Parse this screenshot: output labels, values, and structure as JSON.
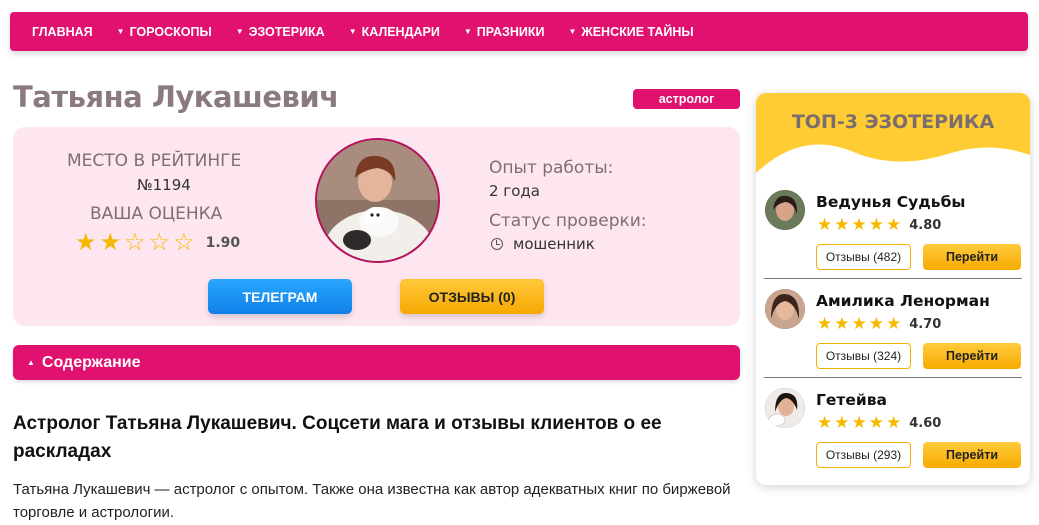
{
  "nav": {
    "items": [
      {
        "label": "ГЛАВНАЯ",
        "has_caret": false
      },
      {
        "label": "ГОРОСКОПЫ",
        "has_caret": true
      },
      {
        "label": "ЭЗОТЕРИКА",
        "has_caret": true
      },
      {
        "label": "КАЛЕНДАРИ",
        "has_caret": true
      },
      {
        "label": "ПРАЗНИКИ",
        "has_caret": true
      },
      {
        "label": "ЖЕНСКИЕ ТАЙНЫ",
        "has_caret": true
      }
    ]
  },
  "profile": {
    "name": "Татьяна Лукашевич",
    "badge": "астролог",
    "rank_label": "МЕСТО В РЕЙТИНГЕ",
    "rank_value": "№1194",
    "score_label": "ВАША ОЦЕНКА",
    "rating_value": "1.90",
    "rating_stars": 2,
    "experience_label": "Опыт работы:",
    "experience_value": "2 года",
    "status_label": "Статус проверки:",
    "status_value": "мошенник",
    "telegram_button": "ТЕЛЕГРАМ",
    "reviews_button": "ОТЗЫВЫ (0)"
  },
  "toc": {
    "label": "Содержание"
  },
  "article": {
    "heading": "Астролог Татьяна Лукашевич. Соцсети мага и отзывы клиентов о ее раскладах",
    "paragraph": "Татьяна Лукашевич — астролог с опытом. Также она известна как автор адекватных книг по биржевой торговле и астрологии."
  },
  "sidebar": {
    "title": "ТОП-3 ЭЗОТЕРИКА",
    "items": [
      {
        "name": "Ведунья Судьбы",
        "rating": "4.80",
        "reviews": "Отзывы (482)",
        "go": "Перейти"
      },
      {
        "name": "Амилика Ленорман",
        "rating": "4.70",
        "reviews": "Отзывы (324)",
        "go": "Перейти"
      },
      {
        "name": "Гетейва",
        "rating": "4.60",
        "reviews": "Отзывы (293)",
        "go": "Перейти"
      }
    ]
  },
  "colors": {
    "brand_pink": "#e0116f",
    "card_bg": "#fde6ef",
    "star_gold": "#f7b900",
    "telegram_blue": "#1a8ff0",
    "sidebar_yellow": "#ffcd33"
  },
  "icons": {
    "status": "clock-icon",
    "nav_caret": "caret-down-icon",
    "toc_toggle": "triangle-up-icon"
  }
}
